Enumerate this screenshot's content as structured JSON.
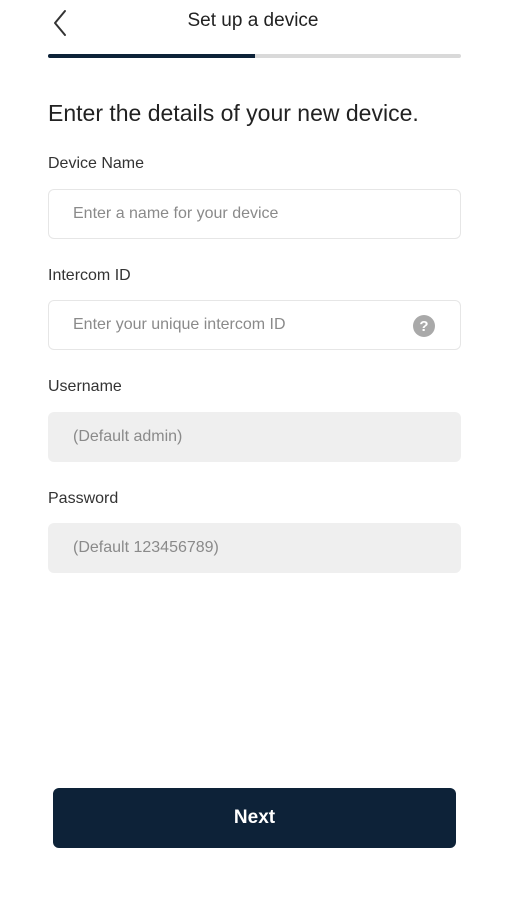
{
  "header": {
    "title": "Set up a device",
    "progress": 0.5
  },
  "heading": "Enter the details of your new device.",
  "fields": {
    "device_name": {
      "label": "Device Name",
      "placeholder": "Enter a name for your device"
    },
    "intercom_id": {
      "label": "Intercom ID",
      "placeholder": "Enter your unique intercom ID",
      "help_glyph": "?"
    },
    "username": {
      "label": "Username",
      "placeholder": "(Default admin)"
    },
    "password": {
      "label": "Password",
      "placeholder": "(Default 123456789)"
    }
  },
  "next_label": "Next",
  "colors": {
    "primary": "#0d2238",
    "track": "#d9d9d9",
    "disabled_field": "#efefef",
    "help_icon": "#a9a9a9"
  },
  "icons": {
    "back": "chevron-left-icon",
    "help": "question-circle-icon"
  }
}
